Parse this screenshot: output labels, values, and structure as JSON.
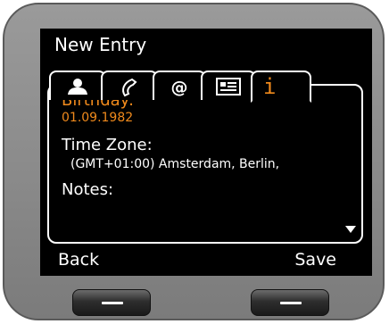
{
  "screen": {
    "title": "New Entry"
  },
  "tabs": [
    {
      "icon": "person-icon",
      "active": false
    },
    {
      "icon": "phone-handset-icon",
      "active": false
    },
    {
      "icon": "at-sign-icon",
      "active": false
    },
    {
      "icon": "contact-card-icon",
      "active": false
    },
    {
      "icon": "info-icon",
      "label": "i",
      "active": true
    }
  ],
  "fields": {
    "birthday": {
      "label": "Birthday:",
      "value": "01.09.1982"
    },
    "timezone": {
      "label": "Time Zone:",
      "value": "(GMT+01:00) Amsterdam, Berlin,"
    },
    "notes": {
      "label": "Notes:"
    }
  },
  "softkeys": {
    "left": "Back",
    "right": "Save"
  },
  "colors": {
    "accent": "#f08a1c",
    "screen_bg": "#000000",
    "body": "#8c8c8c"
  }
}
